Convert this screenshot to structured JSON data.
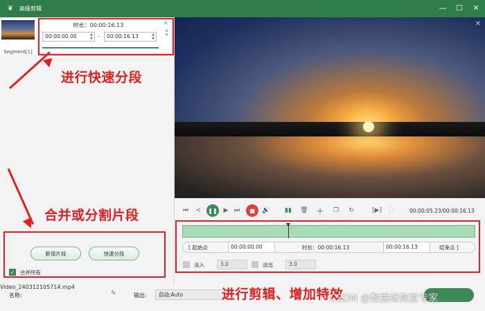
{
  "window": {
    "title": "高级剪辑",
    "min_glyph": "—",
    "max_glyph": "☐",
    "close_glyph": "✕"
  },
  "segments": [
    {
      "label": "Segment[1]"
    }
  ],
  "segment_editor": {
    "duration_label": "时长：00:00:16.13",
    "start_value": "00:00:00.00",
    "end_value": "00:00:16.13",
    "separator": "–"
  },
  "left_actions": {
    "new_segment": "新增片段",
    "quick_split": "快速分段",
    "merge_all": "合并所有",
    "merge_all_checked": true
  },
  "footer": {
    "name_label": "名称:",
    "file_name": "Video_240312105714.mp4",
    "output_label": "输出:",
    "output_value": "自动;Auto"
  },
  "player": {
    "timecode": "00:00:05.23/00:00:16.13"
  },
  "trim": {
    "start_btn": "[   起始点",
    "start_value": "00:00:00.00",
    "duration": "时长：00:00:16.13",
    "end_value": "00:00:16.13",
    "end_btn": "结束点   ]"
  },
  "fade": {
    "fade_in_label": "淡入",
    "fade_in_value": "3.0",
    "fade_out_label": "淡出",
    "fade_out_value": "3.0"
  },
  "annotations": {
    "quick_segment": "进行快速分段",
    "merge_split": "合并或分割片段",
    "edit_effects": "进行剪辑、增加特效"
  },
  "watermark": "CSDN @数据蛙恢复专家",
  "colors": {
    "brand": "#2f7d4a",
    "accent": "#3d8a57",
    "annotation": "#e02020"
  }
}
